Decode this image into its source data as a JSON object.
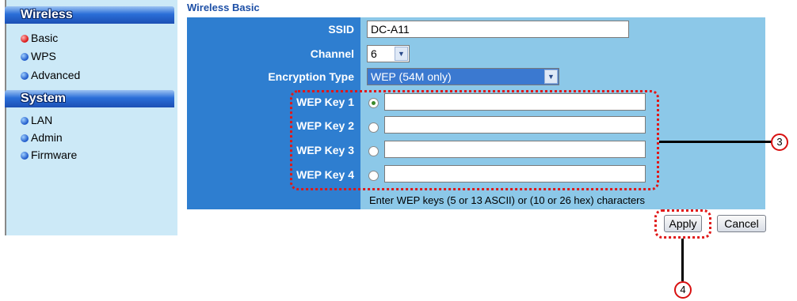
{
  "sidebar": {
    "sections": [
      {
        "title": "Wireless",
        "items": [
          {
            "label": "Basic",
            "active": true
          },
          {
            "label": "WPS",
            "active": false
          },
          {
            "label": "Advanced",
            "active": false
          }
        ]
      },
      {
        "title": "System",
        "items": [
          {
            "label": "LAN",
            "active": false
          },
          {
            "label": "Admin",
            "active": false
          },
          {
            "label": "Firmware",
            "active": false
          }
        ]
      }
    ]
  },
  "page": {
    "title": "Wireless Basic"
  },
  "form": {
    "ssid": {
      "label": "SSID",
      "value": "DC-A11"
    },
    "channel": {
      "label": "Channel",
      "value": "6"
    },
    "encryption": {
      "label": "Encryption Type",
      "value": "WEP (54M only)"
    },
    "wep_keys": [
      {
        "label": "WEP Key 1",
        "value": "",
        "selected": true
      },
      {
        "label": "WEP Key 2",
        "value": "",
        "selected": false
      },
      {
        "label": "WEP Key 3",
        "value": "",
        "selected": false
      },
      {
        "label": "WEP Key 4",
        "value": "",
        "selected": false
      }
    ],
    "hint": "Enter WEP keys (5 or 13 ASCII) or (10 or 26 hex) characters"
  },
  "buttons": {
    "apply": "Apply",
    "cancel": "Cancel"
  },
  "callouts": {
    "keys": "3",
    "apply": "4"
  },
  "colors": {
    "label_column": "#2e7ed0",
    "panel": "#8cc8e8",
    "sidebar": "#cce9f7",
    "callout": "#e01818"
  }
}
